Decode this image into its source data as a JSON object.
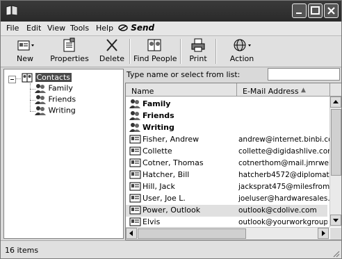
{
  "window": {
    "title": ""
  },
  "menubar": {
    "items": [
      "File",
      "Edit",
      "View",
      "Tools",
      "Help"
    ],
    "send_label": "Send"
  },
  "toolbar": {
    "new": "New",
    "properties": "Properties",
    "delete": "Delete",
    "find_people": "Find People",
    "print": "Print",
    "action": "Action"
  },
  "tree": {
    "root": "Contacts",
    "children": [
      "Family",
      "Friends",
      "Writing"
    ]
  },
  "search": {
    "label": "Type name or select from list:",
    "value": ""
  },
  "list": {
    "columns": {
      "name": "Name",
      "email": "E-Mail Address"
    },
    "groups": [
      "Family",
      "Friends",
      "Writing"
    ],
    "contacts": [
      {
        "name": "Fisher, Andrew",
        "email": "andrew@internet.binbi.con"
      },
      {
        "name": "Collette",
        "email": "collette@digidashlive.com"
      },
      {
        "name": "Cotner, Thomas",
        "email": "cotnerthom@mail.jmrweb."
      },
      {
        "name": "Hatcher, Bill",
        "email": "hatcherb4572@diplomat.n"
      },
      {
        "name": "Hill, Jack",
        "email": "jacksprat475@milesfromh."
      },
      {
        "name": "User, Joe L.",
        "email": "joeluser@hardwaresales.c"
      },
      {
        "name": "Power, Outlook",
        "email": "outlook@cdolive.com"
      },
      {
        "name": "Elvis",
        "email": "outlook@yourworkgroup"
      }
    ]
  },
  "status": {
    "text": "16 items"
  },
  "colors": {
    "titlebar": "#2f2f2f",
    "selection": "#4a4a4a"
  }
}
